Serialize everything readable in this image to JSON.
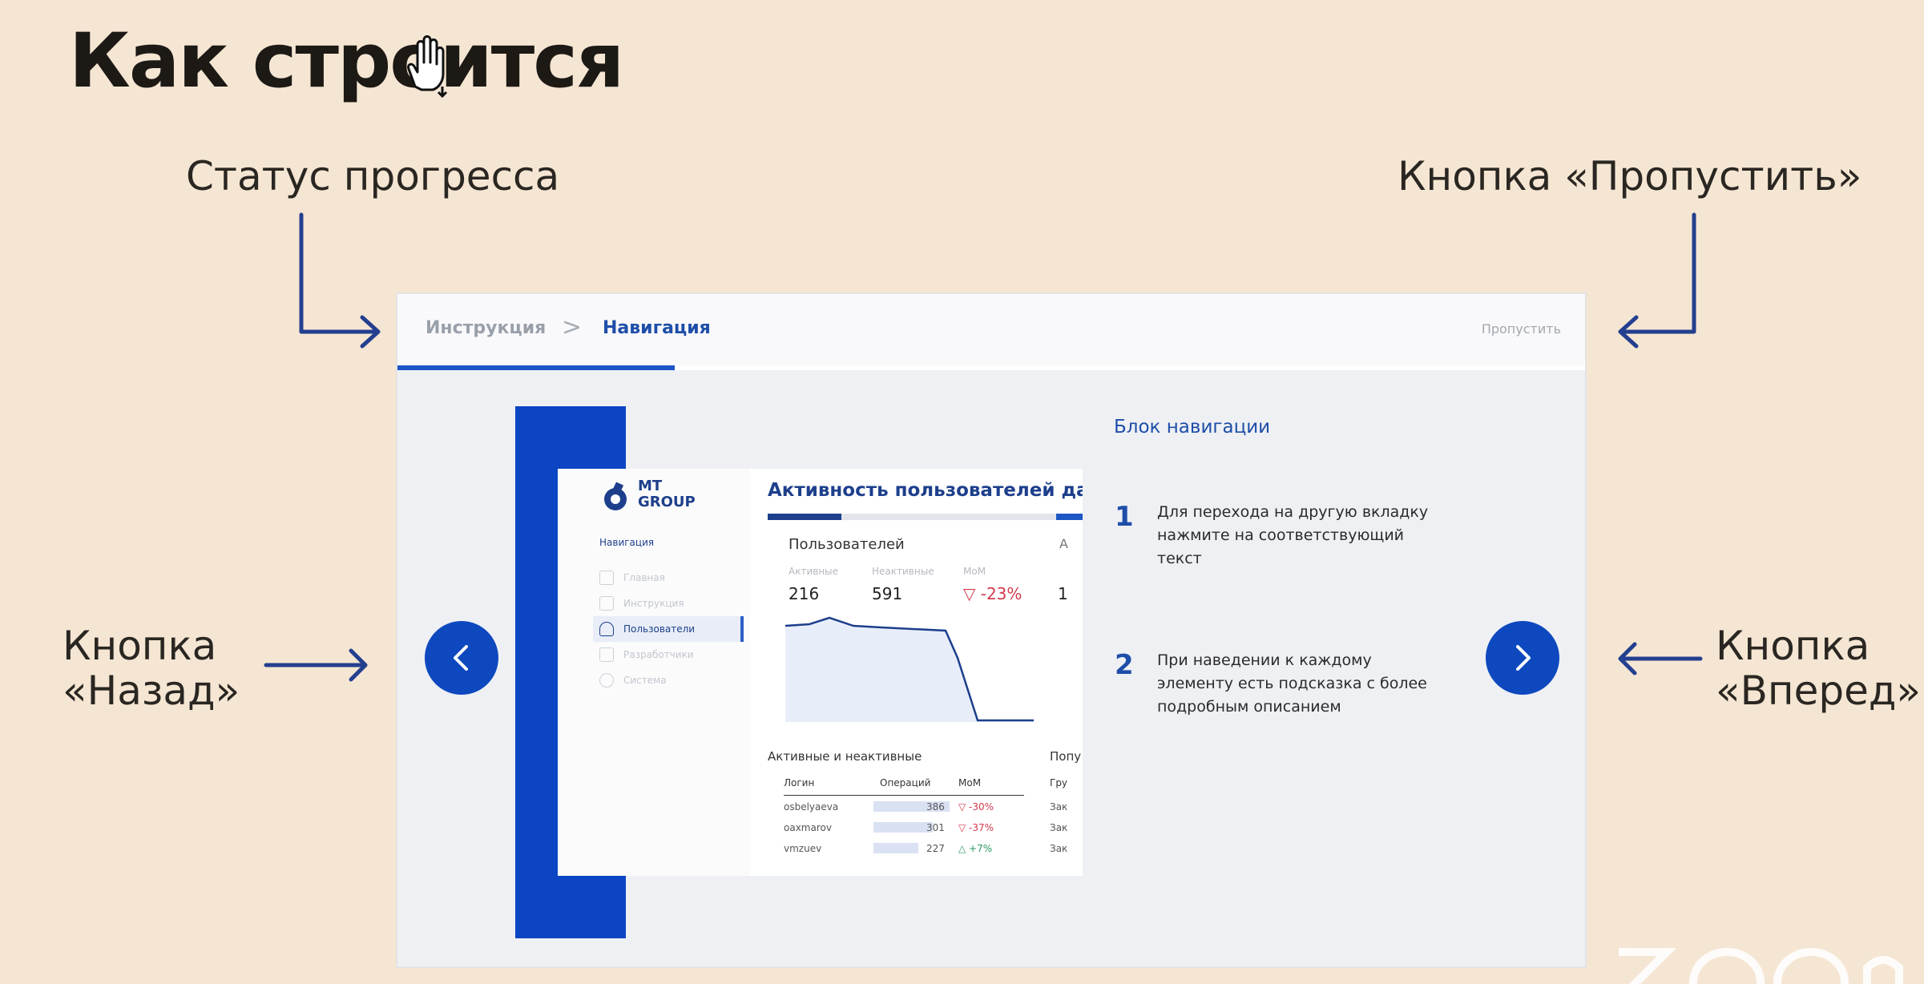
{
  "slide": {
    "title": "Как строится"
  },
  "callouts": {
    "progress": "Статус прогресса",
    "skip": "Кнопка «Пропустить»",
    "back": [
      "Кнопка",
      "«Назад»"
    ],
    "next": [
      "Кнопка",
      "«Вперед»"
    ]
  },
  "wizard": {
    "breadcrumb": {
      "step1": "Инструкция",
      "separator": ">",
      "step2": "Навигация"
    },
    "skip": "Пропустить",
    "progress_fraction": 0.23
  },
  "preview": {
    "logo": [
      "MT",
      "GROUP"
    ],
    "nav_title": "Навигация",
    "nav_items": [
      "Главная",
      "Инструкция",
      "Пользователи",
      "Разработчики",
      "Система"
    ],
    "active_nav": "Пользователи",
    "title": "Активность пользователей дашбо",
    "kpi": {
      "title": "Пользователей",
      "labels": [
        "Активные",
        "Неактивные",
        "MoM"
      ],
      "values": [
        "216",
        "591",
        "▽ -23%"
      ]
    },
    "section_left": "Активные и неактивные",
    "section_right": "Попу",
    "table": {
      "headers": [
        "Логин",
        "Операций",
        "MoM"
      ],
      "rows": [
        {
          "login": "osbelyaeva",
          "ops": "386",
          "mom": "▽ -30%"
        },
        {
          "login": "oaxmarov",
          "ops": "301",
          "mom": "▽ -37%"
        },
        {
          "login": "vmzuev",
          "ops": "227",
          "mom": "△ +7%"
        }
      ],
      "right_col": [
        "Гру",
        "Зак",
        "Зак",
        "Зак"
      ]
    },
    "kpi_right": [
      "А",
      "1"
    ]
  },
  "help": {
    "title": "Блок навигации",
    "items": [
      {
        "num": "1",
        "text": "Для перехода на другую вкладку нажмите на соответствующий текст"
      },
      {
        "num": "2",
        "text": "При наведении к каждому элементу есть подсказка с более подробным описанием"
      }
    ]
  },
  "colors": {
    "accent": "#0d48bf",
    "bg": "#f5e6d3",
    "arrow": "#233f8f",
    "negative": "#d33a4d"
  },
  "icons": {
    "back": "chevron-left-icon",
    "next": "chevron-right-icon",
    "cursor": "hand-cursor-icon"
  }
}
